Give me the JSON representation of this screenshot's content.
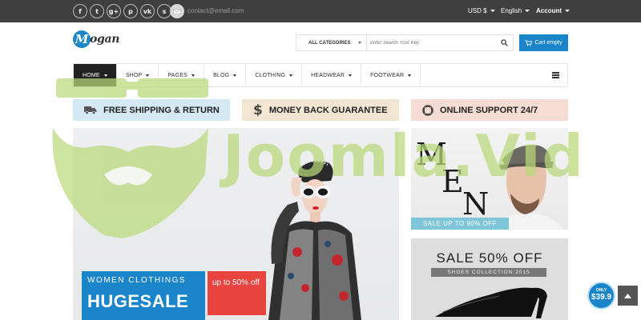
{
  "topbar": {
    "social": [
      {
        "icon": "facebook-icon",
        "glyph": "f"
      },
      {
        "icon": "twitter-icon",
        "glyph": "t"
      },
      {
        "icon": "google-plus-icon",
        "glyph": "g+"
      },
      {
        "icon": "pinterest-icon",
        "glyph": "p"
      },
      {
        "icon": "vk-icon",
        "glyph": "vk"
      },
      {
        "icon": "skype-icon",
        "glyph": "s"
      }
    ],
    "contact_email": "contact@email.com",
    "currency": "USD $",
    "language": "English",
    "account": "Account"
  },
  "header": {
    "logo_letter": "M",
    "logo_rest": "ogan",
    "search": {
      "category_label": "ALL CATEGORIES",
      "placeholder": "Enter Search Your Key"
    },
    "cart_label": "Cart empty"
  },
  "nav": {
    "items": [
      {
        "label": "HOME",
        "active": true
      },
      {
        "label": "SHOP"
      },
      {
        "label": "PAGES"
      },
      {
        "label": "BLOG"
      },
      {
        "label": "CLOTHING"
      },
      {
        "label": "HEADWEAR"
      },
      {
        "label": "FOOTWEAR"
      }
    ]
  },
  "features": [
    {
      "label": "FREE SHIPPING & RETURN",
      "icon": "truck-icon",
      "bg": "#d4e9f4"
    },
    {
      "label": "MONEY BACK GUARANTEE",
      "icon": "dollar-icon",
      "bg": "#f2e5d2"
    },
    {
      "label": "ONLINE SUPPORT 24/7",
      "icon": "lifebuoy-icon",
      "bg": "#f7dcd3"
    }
  ],
  "banner": {
    "line1": "WOMEN CLOTHINGS",
    "line2": "HUGESALE",
    "discount": "up to 50% off"
  },
  "ads": {
    "men_letters": [
      "M",
      "E",
      "N"
    ],
    "men_strip": "SALE UP TO 90% OFF",
    "sale_heading": "SALE 50% OFF",
    "sale_sub": "SHOES COLLECTION 2015"
  },
  "watermark": "Joomla.Vid",
  "price_badge": {
    "only": "ONLY",
    "price": "$39.9"
  },
  "colors": {
    "primary": "#1b85c9",
    "accent_red": "#e8433f",
    "topbar": "#3f3f3f",
    "watermark": "#b9d97a"
  }
}
